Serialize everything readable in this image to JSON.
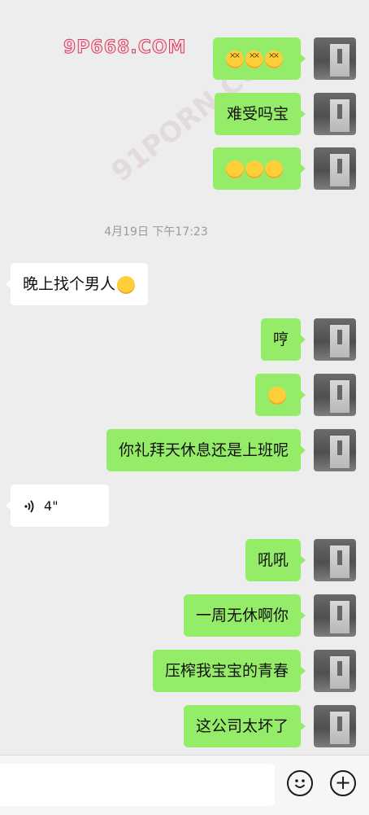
{
  "watermark": "9P668.COM",
  "watermark_diagonal": "91PORN.COM",
  "timestamp": "4月19日 下午17:23",
  "messages": [
    {
      "side": "me",
      "type": "emoji",
      "emoji_name": "dizzy-face-emoji",
      "count": 3
    },
    {
      "side": "me",
      "type": "text",
      "text": "难受吗宝"
    },
    {
      "side": "me",
      "type": "emoji",
      "emoji_name": "hand-over-mouth-emoji",
      "count": 3
    },
    {
      "side": "them",
      "type": "text",
      "text": "晚上找个男人",
      "emoji_name": "unamused-face-emoji"
    },
    {
      "side": "me",
      "type": "text",
      "text": "哼"
    },
    {
      "side": "me",
      "type": "emoji",
      "emoji_name": "confused-face-emoji",
      "count": 1
    },
    {
      "side": "me",
      "type": "text",
      "text": "你礼拜天休息还是上班呢"
    },
    {
      "side": "them",
      "type": "voice",
      "duration": "4\""
    },
    {
      "side": "me",
      "type": "text",
      "text": "吼吼"
    },
    {
      "side": "me",
      "type": "text",
      "text": "一周无休啊你"
    },
    {
      "side": "me",
      "type": "text",
      "text": "压榨我宝宝的青春"
    },
    {
      "side": "me",
      "type": "text",
      "text": "这公司太坏了"
    }
  ],
  "bottom_bar": {
    "emoji_icon": "smiley-icon",
    "plus_icon": "plus-icon"
  },
  "colors": {
    "my_bubble": "#95ec69",
    "their_bubble": "#ffffff",
    "background": "#ededed"
  }
}
